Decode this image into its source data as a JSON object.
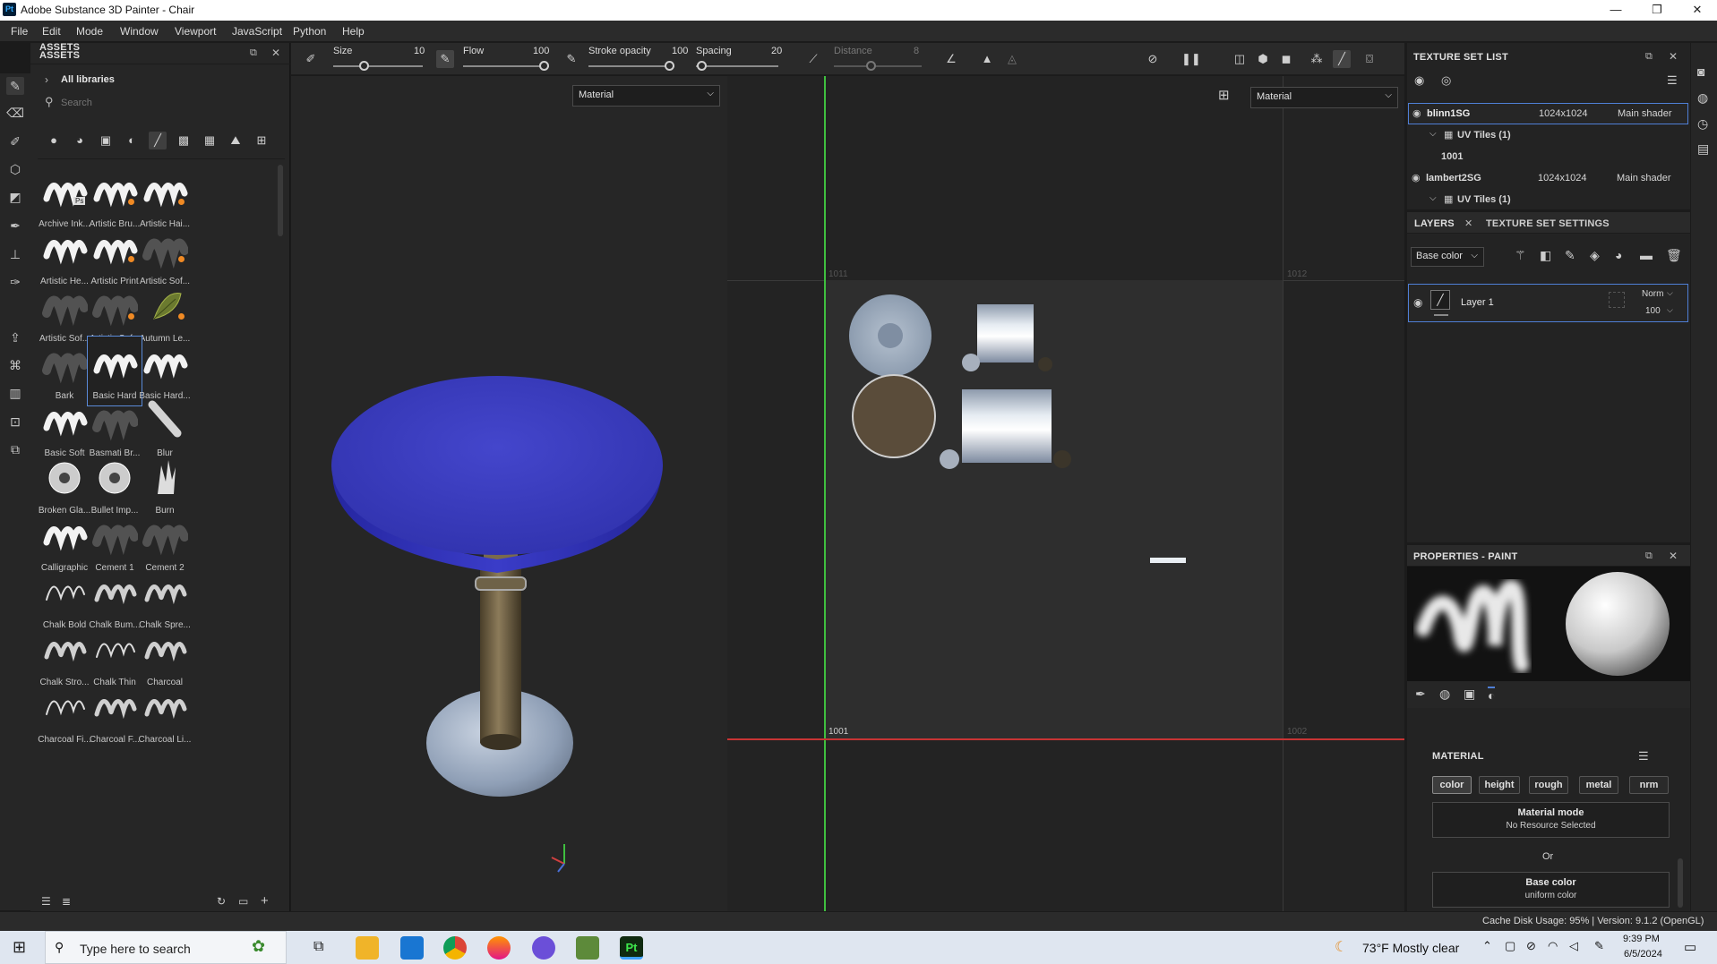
{
  "window": {
    "app_icon": "Pt",
    "title": "Adobe Substance 3D Painter - Chair",
    "min": "—",
    "max": "❐",
    "close": "✕"
  },
  "menu": [
    "File",
    "Edit",
    "Mode",
    "Window",
    "Viewport",
    "JavaScript",
    "Python",
    "Help"
  ],
  "assets": {
    "title": "ASSETS",
    "breadcrumb": "All libraries",
    "search_placeholder": "Search",
    "brushes": [
      "Archive Ink...",
      "Artistic Bru...",
      "Artistic Hai...",
      "Artistic He...",
      "Artistic Print",
      "Artistic Sof...",
      "Artistic Sof...",
      "Artistic Sof...",
      "Autumn Le...",
      "Bark",
      "Basic Hard",
      "Basic Hard...",
      "Basic Soft",
      "Basmati Br...",
      "Blur",
      "Broken Gla...",
      "Bullet Imp...",
      "Burn",
      "Calligraphic",
      "Cement 1",
      "Cement 2",
      "Chalk Bold",
      "Chalk Bum...",
      "Chalk Spre...",
      "Chalk Stro...",
      "Chalk Thin",
      "Charcoal",
      "Charcoal Fi...",
      "Charcoal F...",
      "Charcoal Li..."
    ],
    "selected_brush": "Basic Hard",
    "ps_badge": "Ps"
  },
  "toolbar": {
    "size_label": "Size",
    "size_value": "10",
    "flow_label": "Flow",
    "flow_value": "100",
    "stroke_label": "Stroke opacity",
    "stroke_value": "100",
    "spacing_label": "Spacing",
    "spacing_value": "20",
    "distance_label": "Distance",
    "distance_value": "8",
    "levels": {
      "size": 0.08,
      "flow": 1.0,
      "stroke": 1.0,
      "spacing": 0.02,
      "distance": 0.3
    }
  },
  "viewport3d": {
    "mode": "Material"
  },
  "viewport2d": {
    "mode": "Material",
    "tile_1011": "1011",
    "tile_1012": "1012",
    "tile_1001": "1001",
    "tile_1002": "1002"
  },
  "texture_set": {
    "title": "TEXTURE SET LIST",
    "sets": [
      {
        "name": "blinn1SG",
        "res": "1024x1024",
        "shader": "Main shader",
        "uv": "UV Tiles (1)",
        "tile": "1001"
      },
      {
        "name": "lambert2SG",
        "res": "1024x1024",
        "shader": "Main shader",
        "uv": "UV Tiles (1)"
      }
    ]
  },
  "layers": {
    "tab1": "LAYERS",
    "tab2": "TEXTURE SET SETTINGS",
    "channel": "Base color",
    "layer_name": "Layer 1",
    "blend": "Norm",
    "opacity": "100"
  },
  "properties": {
    "title": "PROPERTIES - PAINT",
    "section": "MATERIAL",
    "channels": [
      "color",
      "height",
      "rough",
      "metal",
      "nrm"
    ],
    "mode_title": "Material mode",
    "mode_sub": "No Resource Selected",
    "or": "Or",
    "base_title": "Base color",
    "base_sub": "uniform color"
  },
  "status": {
    "text": "Cache Disk Usage:  95% | Version: 9.1.2 (OpenGL)"
  },
  "taskbar": {
    "search": "Type here to search",
    "weather": "73°F  Mostly clear",
    "time": "9:39 PM",
    "date": "6/5/2024"
  },
  "colors": {
    "accent": "#4f7fd6",
    "seat": "#3a3bb8",
    "green_axis": "#3fbf3f",
    "red_axis": "#c83434"
  }
}
